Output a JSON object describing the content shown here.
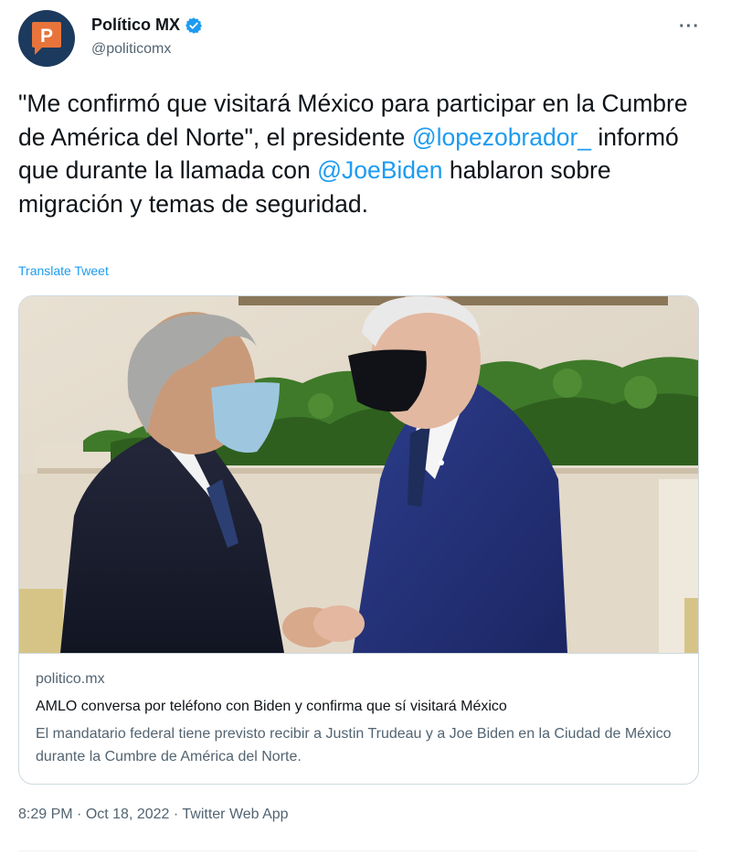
{
  "author": {
    "display_name": "Político MX",
    "handle": "@politicomx",
    "avatar_icon": "politico-p-logo-icon",
    "verified_icon": "verified-badge-icon"
  },
  "more_icon": "more-options-icon",
  "tweet": {
    "text_part1": "\"Me confirmó que visitará México para participar en la Cumbre de América del Norte\", el presidente ",
    "mention1": "@lopezobrador_",
    "text_part2": " informó que durante la llamada con ",
    "mention2": "@JoeBiden",
    "text_part3": " hablaron sobre migración y temas de seguridad.",
    "translate_label": "Translate Tweet"
  },
  "link_card": {
    "domain": "politico.mx",
    "title": "AMLO conversa por teléfono con Biden y confirma que sí visitará México",
    "description": "El mandatario federal tiene previsto recibir a Justin Trudeau y a Joe Biden en la Ciudad de México durante la Cumbre de América del Norte."
  },
  "meta": {
    "time": "8:29 PM",
    "date": "Oct 18, 2022",
    "source": "Twitter Web App",
    "separator": " · "
  },
  "colors": {
    "link": "#1d9bf0",
    "secondary_text": "#536471",
    "brand_orange": "#e8743b",
    "avatar_bg": "#1c3a5e"
  }
}
